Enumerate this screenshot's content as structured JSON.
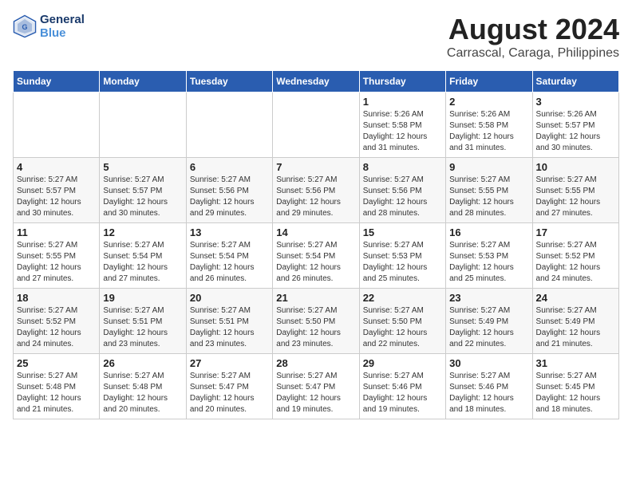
{
  "header": {
    "logo_line1": "General",
    "logo_line2": "Blue",
    "title": "August 2024",
    "subtitle": "Carrascal, Caraga, Philippines"
  },
  "calendar": {
    "days_of_week": [
      "Sunday",
      "Monday",
      "Tuesday",
      "Wednesday",
      "Thursday",
      "Friday",
      "Saturday"
    ],
    "weeks": [
      [
        {
          "day": "",
          "info": ""
        },
        {
          "day": "",
          "info": ""
        },
        {
          "day": "",
          "info": ""
        },
        {
          "day": "",
          "info": ""
        },
        {
          "day": "1",
          "info": "Sunrise: 5:26 AM\nSunset: 5:58 PM\nDaylight: 12 hours and 31 minutes."
        },
        {
          "day": "2",
          "info": "Sunrise: 5:26 AM\nSunset: 5:58 PM\nDaylight: 12 hours and 31 minutes."
        },
        {
          "day": "3",
          "info": "Sunrise: 5:26 AM\nSunset: 5:57 PM\nDaylight: 12 hours and 30 minutes."
        }
      ],
      [
        {
          "day": "4",
          "info": "Sunrise: 5:27 AM\nSunset: 5:57 PM\nDaylight: 12 hours and 30 minutes."
        },
        {
          "day": "5",
          "info": "Sunrise: 5:27 AM\nSunset: 5:57 PM\nDaylight: 12 hours and 30 minutes."
        },
        {
          "day": "6",
          "info": "Sunrise: 5:27 AM\nSunset: 5:56 PM\nDaylight: 12 hours and 29 minutes."
        },
        {
          "day": "7",
          "info": "Sunrise: 5:27 AM\nSunset: 5:56 PM\nDaylight: 12 hours and 29 minutes."
        },
        {
          "day": "8",
          "info": "Sunrise: 5:27 AM\nSunset: 5:56 PM\nDaylight: 12 hours and 28 minutes."
        },
        {
          "day": "9",
          "info": "Sunrise: 5:27 AM\nSunset: 5:55 PM\nDaylight: 12 hours and 28 minutes."
        },
        {
          "day": "10",
          "info": "Sunrise: 5:27 AM\nSunset: 5:55 PM\nDaylight: 12 hours and 27 minutes."
        }
      ],
      [
        {
          "day": "11",
          "info": "Sunrise: 5:27 AM\nSunset: 5:55 PM\nDaylight: 12 hours and 27 minutes."
        },
        {
          "day": "12",
          "info": "Sunrise: 5:27 AM\nSunset: 5:54 PM\nDaylight: 12 hours and 27 minutes."
        },
        {
          "day": "13",
          "info": "Sunrise: 5:27 AM\nSunset: 5:54 PM\nDaylight: 12 hours and 26 minutes."
        },
        {
          "day": "14",
          "info": "Sunrise: 5:27 AM\nSunset: 5:54 PM\nDaylight: 12 hours and 26 minutes."
        },
        {
          "day": "15",
          "info": "Sunrise: 5:27 AM\nSunset: 5:53 PM\nDaylight: 12 hours and 25 minutes."
        },
        {
          "day": "16",
          "info": "Sunrise: 5:27 AM\nSunset: 5:53 PM\nDaylight: 12 hours and 25 minutes."
        },
        {
          "day": "17",
          "info": "Sunrise: 5:27 AM\nSunset: 5:52 PM\nDaylight: 12 hours and 24 minutes."
        }
      ],
      [
        {
          "day": "18",
          "info": "Sunrise: 5:27 AM\nSunset: 5:52 PM\nDaylight: 12 hours and 24 minutes."
        },
        {
          "day": "19",
          "info": "Sunrise: 5:27 AM\nSunset: 5:51 PM\nDaylight: 12 hours and 23 minutes."
        },
        {
          "day": "20",
          "info": "Sunrise: 5:27 AM\nSunset: 5:51 PM\nDaylight: 12 hours and 23 minutes."
        },
        {
          "day": "21",
          "info": "Sunrise: 5:27 AM\nSunset: 5:50 PM\nDaylight: 12 hours and 23 minutes."
        },
        {
          "day": "22",
          "info": "Sunrise: 5:27 AM\nSunset: 5:50 PM\nDaylight: 12 hours and 22 minutes."
        },
        {
          "day": "23",
          "info": "Sunrise: 5:27 AM\nSunset: 5:49 PM\nDaylight: 12 hours and 22 minutes."
        },
        {
          "day": "24",
          "info": "Sunrise: 5:27 AM\nSunset: 5:49 PM\nDaylight: 12 hours and 21 minutes."
        }
      ],
      [
        {
          "day": "25",
          "info": "Sunrise: 5:27 AM\nSunset: 5:48 PM\nDaylight: 12 hours and 21 minutes."
        },
        {
          "day": "26",
          "info": "Sunrise: 5:27 AM\nSunset: 5:48 PM\nDaylight: 12 hours and 20 minutes."
        },
        {
          "day": "27",
          "info": "Sunrise: 5:27 AM\nSunset: 5:47 PM\nDaylight: 12 hours and 20 minutes."
        },
        {
          "day": "28",
          "info": "Sunrise: 5:27 AM\nSunset: 5:47 PM\nDaylight: 12 hours and 19 minutes."
        },
        {
          "day": "29",
          "info": "Sunrise: 5:27 AM\nSunset: 5:46 PM\nDaylight: 12 hours and 19 minutes."
        },
        {
          "day": "30",
          "info": "Sunrise: 5:27 AM\nSunset: 5:46 PM\nDaylight: 12 hours and 18 minutes."
        },
        {
          "day": "31",
          "info": "Sunrise: 5:27 AM\nSunset: 5:45 PM\nDaylight: 12 hours and 18 minutes."
        }
      ]
    ]
  }
}
